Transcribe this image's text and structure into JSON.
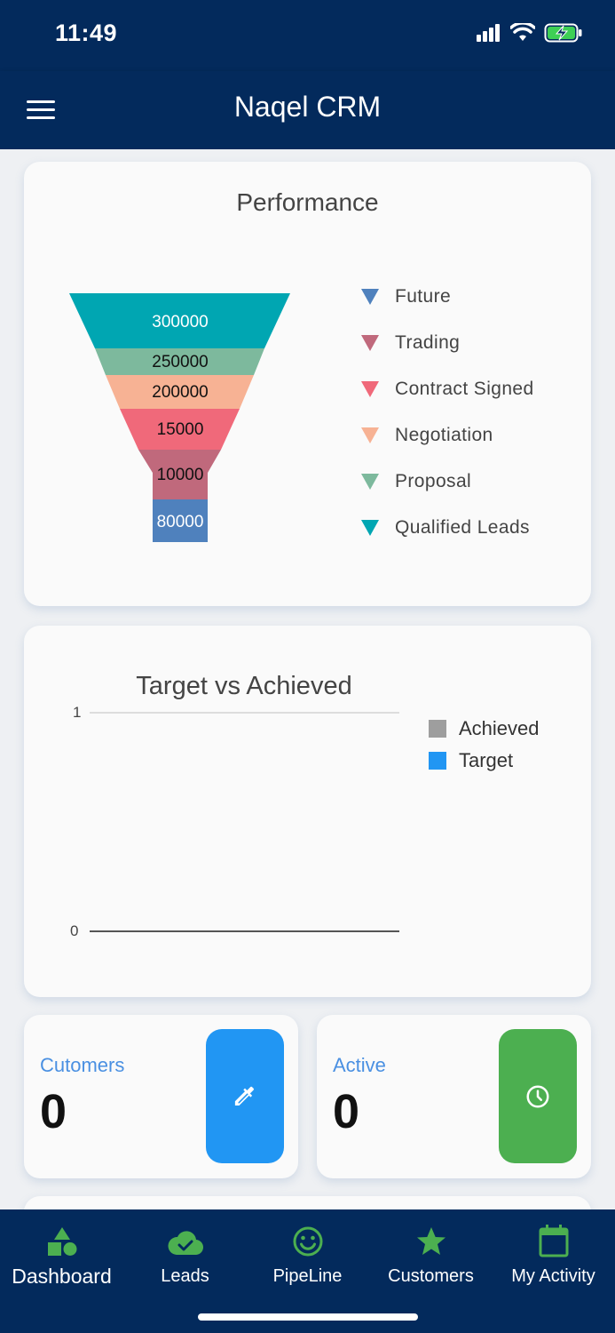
{
  "status_bar": {
    "time": "11:49"
  },
  "app_bar": {
    "title": "Naqel CRM"
  },
  "performance": {
    "title": "Performance",
    "funnel_values": [
      "300000",
      "250000",
      "200000",
      "15000",
      "10000",
      "80000"
    ],
    "legend": [
      {
        "label": "Future",
        "color": "#4f81bd"
      },
      {
        "label": "Trading",
        "color": "#c0697c"
      },
      {
        "label": "Contract Signed",
        "color": "#f0697a"
      },
      {
        "label": "Negotiation",
        "color": "#f7b294"
      },
      {
        "label": "Proposal",
        "color": "#7db99d"
      },
      {
        "label": "Qualified Leads",
        "color": "#00a6b2"
      }
    ]
  },
  "chart_data": {
    "type": "bar",
    "title": "Target vs Achieved",
    "categories": [],
    "series": [
      {
        "name": "Achieved",
        "values": []
      },
      {
        "name": "Target",
        "values": []
      }
    ],
    "ylim": [
      0,
      1
    ],
    "y_ticks": [
      "1",
      "0"
    ],
    "colors": {
      "Achieved": "#9e9e9e",
      "Target": "#2196f3"
    },
    "legend": "right"
  },
  "stats": {
    "customers": {
      "label": "Cutomers",
      "value": "0",
      "tile_color": "#2196f3",
      "icon": "eyedropper-icon"
    },
    "active": {
      "label": "Active",
      "value": "0",
      "tile_color": "#4caf50",
      "icon": "clock-icon"
    }
  },
  "bottom_nav": {
    "items": [
      {
        "label": "Dashboard",
        "icon": "shapes-icon",
        "active": true
      },
      {
        "label": "Leads",
        "icon": "cloud-check-icon"
      },
      {
        "label": "PipeLine",
        "icon": "smiley-icon"
      },
      {
        "label": "Customers",
        "icon": "star-icon"
      },
      {
        "label": "My Activity",
        "icon": "calendar-icon"
      }
    ],
    "accent_color": "#4caf50"
  }
}
